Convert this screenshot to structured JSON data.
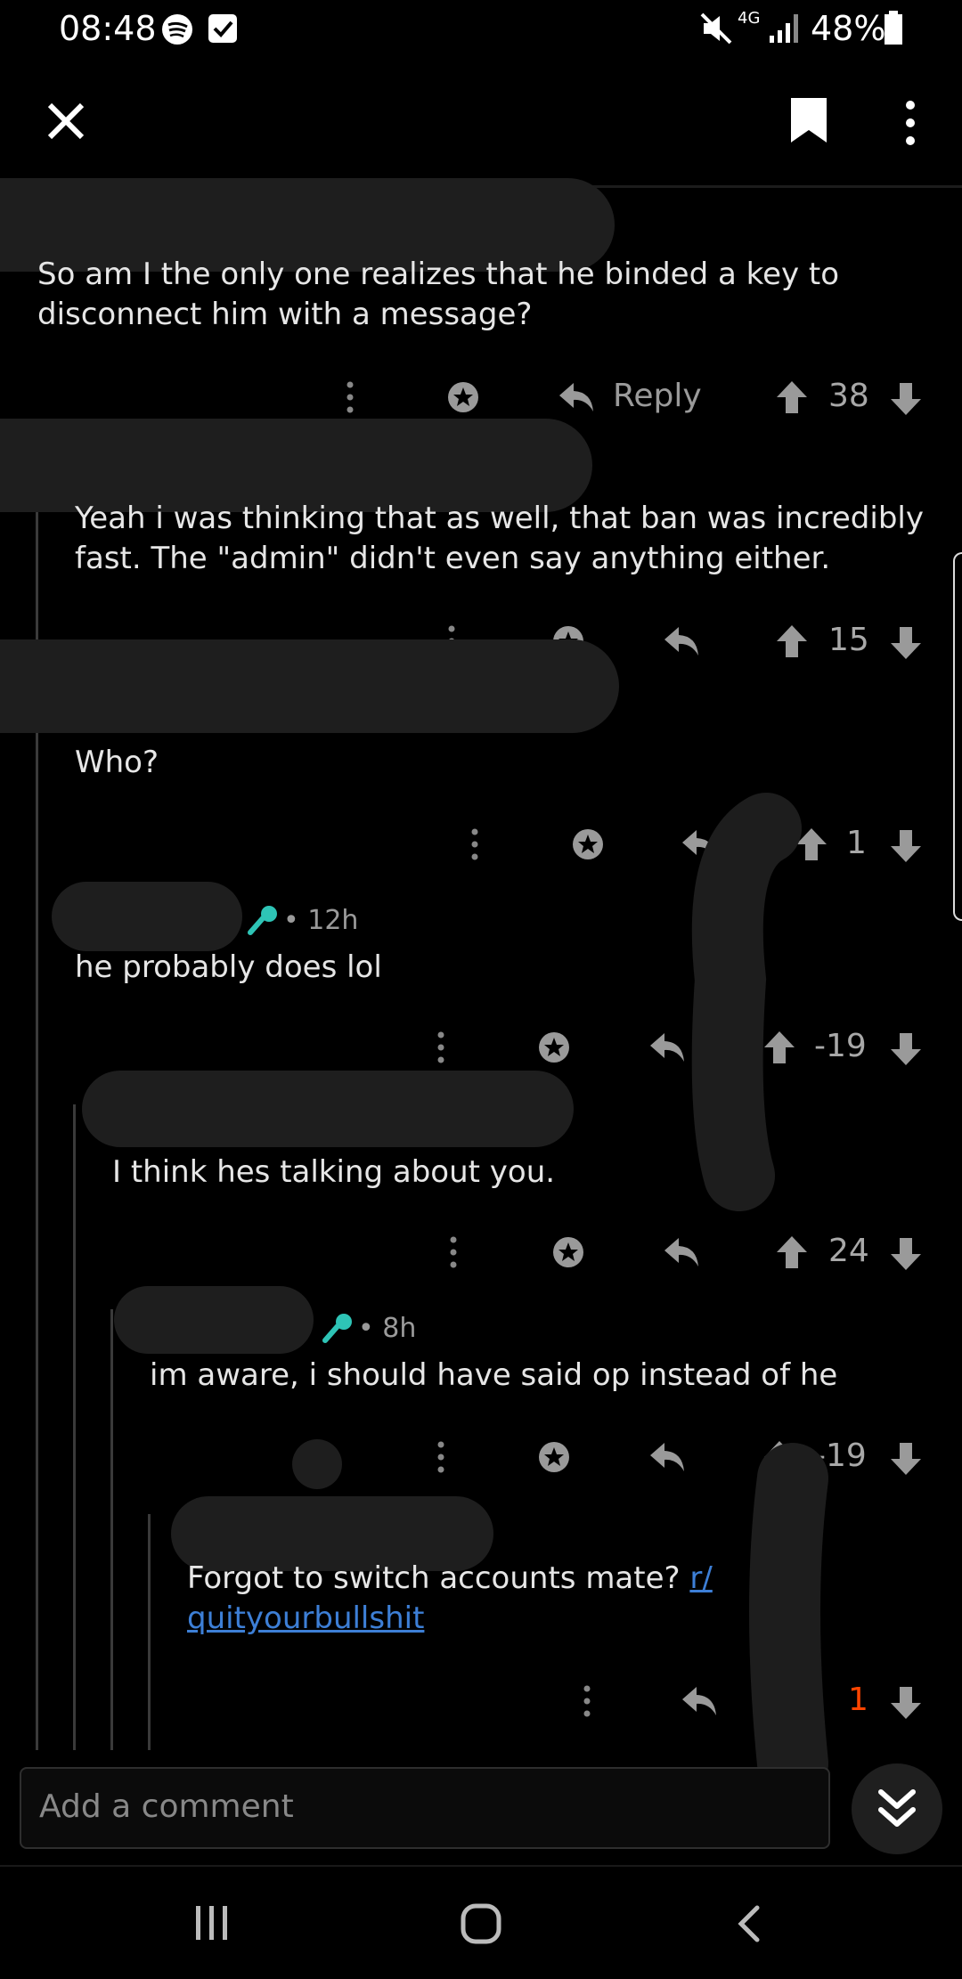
{
  "status_bar": {
    "time": "08:48",
    "network": "4G",
    "battery": "48%"
  },
  "top_bar": {
    "close_icon": "close-icon",
    "save_icon": "bookmark-icon",
    "more_icon": "more-vert-icon"
  },
  "comments": [
    {
      "text": "So am I the only one realizes that he binded a key to disconnect him with a message?",
      "reply_label": "Reply",
      "score": "38"
    },
    {
      "text": "Yeah i was thinking that as well, that ban was incredibly fast. The \"admin\" didn't even say anything either.",
      "score": "15"
    },
    {
      "text": "Who?",
      "score": "1"
    },
    {
      "meta_time": "12h",
      "text": "he probably does lol",
      "score": "-19"
    },
    {
      "text": "I think hes talking about you.",
      "score": "24"
    },
    {
      "meta_time": "8h",
      "text": "im aware, i should have said op instead of he",
      "score": "-19"
    },
    {
      "text_prefix": "Forgot to switch accounts mate? ",
      "link_line1": "r/",
      "link_line2": "quityourbullshit",
      "score": "1",
      "score_color": "#ff4500"
    }
  ],
  "comment_bar": {
    "placeholder": "Add a comment"
  },
  "colors": {
    "accent_link": "#3d7fd6",
    "flair_teal": "#2ec4b6",
    "downvoted_score": "#ff4500"
  }
}
